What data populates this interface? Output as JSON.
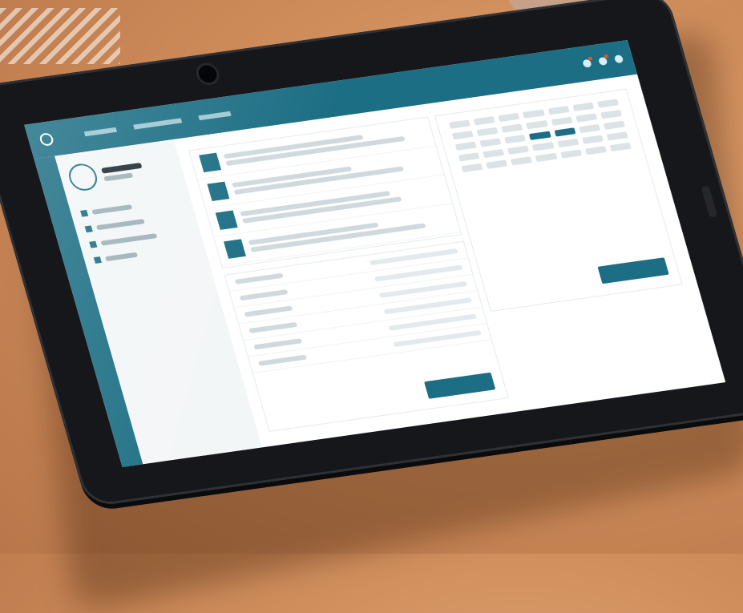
{
  "scene": "tablet-on-table"
}
